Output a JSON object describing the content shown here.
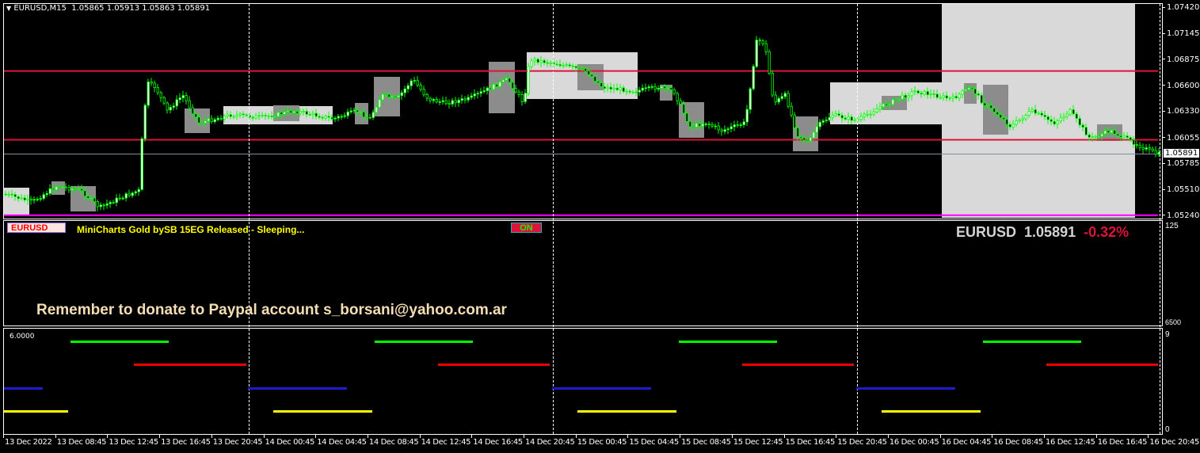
{
  "header": {
    "title": "EURUSD,M15",
    "ohlc": "1.05865 1.05913 1.05863 1.05891"
  },
  "price_axis": {
    "ticks": [
      "1.07420",
      "1.07145",
      "1.06875",
      "1.06600",
      "1.06330",
      "1.06055",
      "1.05785",
      "1.05510",
      "1.05240"
    ],
    "current": "1.05891"
  },
  "levels": {
    "resistance": 1.0676,
    "support": 1.0604,
    "bottom": 1.0525,
    "current": 1.05891
  },
  "colors": {
    "candle": "#00ff00",
    "level": "#dc143c",
    "bottom": "#ff00ff",
    "current": "#7f8c9a"
  },
  "indicator": {
    "symbol_badge": "EURUSD",
    "status_text": "MiniCharts Gold bySB 15EG Released - Sleeping...",
    "on_button": "ON",
    "ticker_symbol": "EURUSD",
    "ticker_price": "1.05891",
    "ticker_change": "-0.32%",
    "donate_text": "Remember to donate to Paypal account s_borsani@yahoo.com.ar",
    "scale_top": "125",
    "scale_bottom": "6500"
  },
  "subwindow": {
    "value_label": "6.0000",
    "scale_top": "9",
    "scale_bottom": "0"
  },
  "time_axis": [
    "13 Dec 2022",
    "13 Dec 08:45",
    "13 Dec 12:45",
    "13 Dec 16:45",
    "13 Dec 20:45",
    "14 Dec 00:45",
    "14 Dec 04:45",
    "14 Dec 08:45",
    "14 Dec 12:45",
    "14 Dec 16:45",
    "14 Dec 20:45",
    "15 Dec 00:45",
    "15 Dec 04:45",
    "15 Dec 08:45",
    "15 Dec 12:45",
    "15 Dec 16:45",
    "15 Dec 20:45",
    "16 Dec 00:45",
    "16 Dec 04:45",
    "16 Dec 08:45",
    "16 Dec 12:45",
    "16 Dec 16:45",
    "16 Dec 20:45"
  ],
  "price_path": [
    [
      4.9,
      1.05472
    ],
    [
      7.0,
      1.05389
    ],
    [
      8.9,
      1.05555
    ],
    [
      10.7,
      1.05513
    ],
    [
      12.2,
      1.05331
    ],
    [
      13.75,
      1.05431
    ],
    [
      15.3,
      1.05513
    ],
    [
      15.5,
      1.06177
    ],
    [
      15.9,
      1.06632
    ],
    [
      16.5,
      1.06591
    ],
    [
      17.4,
      1.06342
    ],
    [
      18.6,
      1.06508
    ],
    [
      19.85,
      1.06218
    ],
    [
      21.1,
      1.06259
    ],
    [
      22.3,
      1.06301
    ],
    [
      24.7,
      1.06276
    ],
    [
      27.2,
      1.06342
    ],
    [
      30.2,
      1.06259
    ],
    [
      32.0,
      1.06342
    ],
    [
      33.0,
      1.06259
    ],
    [
      33.9,
      1.06508
    ],
    [
      35.1,
      1.06467
    ],
    [
      36.3,
      1.06674
    ],
    [
      37.5,
      1.06467
    ],
    [
      38.75,
      1.06425
    ],
    [
      40.6,
      1.06467
    ],
    [
      42.4,
      1.06591
    ],
    [
      43.6,
      1.06674
    ],
    [
      44.85,
      1.06425
    ],
    [
      45.3,
      1.06881
    ],
    [
      47.3,
      1.0684
    ],
    [
      49.7,
      1.06757
    ],
    [
      50.9,
      1.06591
    ],
    [
      53.4,
      1.0655
    ],
    [
      55.2,
      1.06591
    ],
    [
      56.4,
      1.0655
    ],
    [
      57.65,
      1.06177
    ],
    [
      58.9,
      1.06218
    ],
    [
      60.1,
      1.06135
    ],
    [
      61.9,
      1.06218
    ],
    [
      62.8,
      1.07088
    ],
    [
      63.4,
      1.07047
    ],
    [
      64.1,
      1.06425
    ],
    [
      65.0,
      1.06508
    ],
    [
      65.9,
      1.06094
    ],
    [
      66.8,
      1.06011
    ],
    [
      67.4,
      1.06177
    ],
    [
      68.6,
      1.06301
    ],
    [
      70.5,
      1.06243
    ],
    [
      72.3,
      1.06384
    ],
    [
      75.0,
      1.0655
    ],
    [
      77.8,
      1.06467
    ],
    [
      79.3,
      1.06591
    ],
    [
      80.2,
      1.06425
    ],
    [
      81.4,
      1.06301
    ],
    [
      82.35,
      1.06177
    ],
    [
      83.9,
      1.06342
    ],
    [
      85.7,
      1.06218
    ],
    [
      86.9,
      1.06342
    ],
    [
      88.45,
      1.06052
    ],
    [
      90.0,
      1.06135
    ],
    [
      91.2,
      1.06052
    ],
    [
      92.4,
      1.05969
    ],
    [
      93.6,
      1.05887
    ]
  ]
}
